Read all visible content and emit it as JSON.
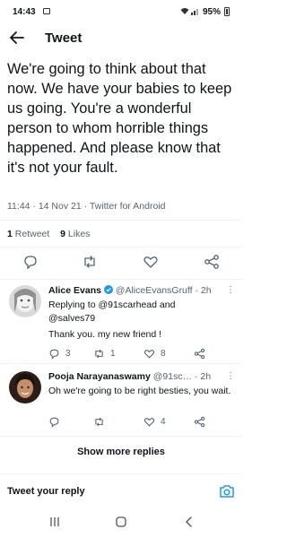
{
  "status_bar": {
    "time": "14:43",
    "battery": "95%",
    "icons": [
      "image-icon",
      "wifi-icon",
      "signal-icon",
      "battery-icon"
    ]
  },
  "header": {
    "title": "Tweet"
  },
  "tweet": {
    "text": "We're going to think about that now. We have your babies to keep us going. You're a wonderful person to whom horrible things happened. And please know that it's not your fault.",
    "meta": "11:44 · 14 Nov 21 · Twitter for Android",
    "retweets_count": "1",
    "retweets_label": "Retweet",
    "likes_count": "9",
    "likes_label": "Likes"
  },
  "replies": [
    {
      "name": "Alice Evans",
      "verified": true,
      "handle": "@AliceEvansGruff",
      "age": "· 2h",
      "replying_line1": "Replying to @91scarhead and",
      "replying_line2": "@salves79",
      "text": "Thank you. my new friend !",
      "reply_count": "3",
      "retweet_count": "1",
      "like_count": "8"
    },
    {
      "name": "Pooja Narayanaswamy",
      "handle": "@91sc…",
      "age": "· 2h",
      "text": "Oh we're going to be right besties, you wait.",
      "reply_count": "",
      "retweet_count": "",
      "like_count": "4"
    }
  ],
  "show_more_label": "Show more replies",
  "compose": {
    "placeholder": "Tweet your reply"
  },
  "colors": {
    "accent": "#1d9bf0",
    "text": "#0f1419",
    "secondary": "#536471",
    "divider": "#eff3f4"
  }
}
